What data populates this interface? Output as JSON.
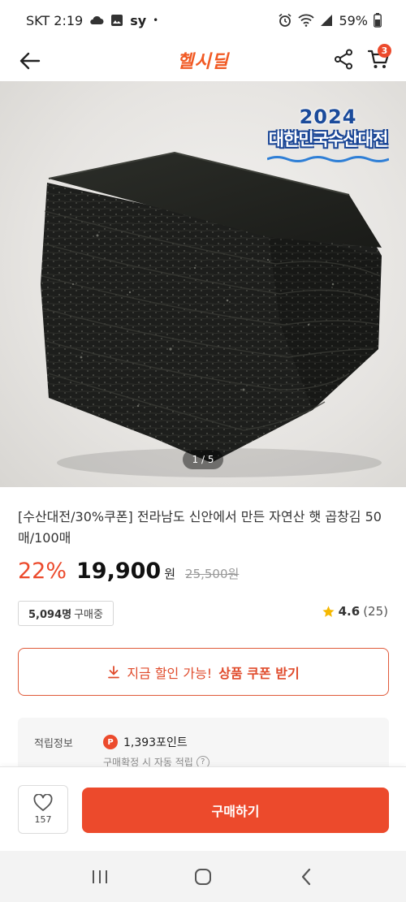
{
  "status_bar": {
    "carrier_time": "SKT 2:19",
    "notif_text": "sy",
    "dot": "•",
    "battery": "59%"
  },
  "header": {
    "logo": "헬시딜",
    "cart_count": "3",
    "icons": [
      "back-arrow-icon",
      "share-icon",
      "cart-icon"
    ]
  },
  "product_image": {
    "badge_year": "2024",
    "badge_title": "대한민국수산대전",
    "counter": "1 / 5"
  },
  "product": {
    "title": "[수산대전/30%쿠폰] 전라남도 신안에서 만든 자연산 햇 곱창김 50매/100매",
    "discount": "22%",
    "price": "19,900",
    "currency": "원",
    "original_price": "25,500원",
    "buyers_count": "5,094명",
    "buyers_suffix": "구매중",
    "rating": "4.6",
    "review_count": "(25)"
  },
  "coupon": {
    "prefix": "지금 할인 가능!",
    "label": "상품 쿠폰 받기"
  },
  "points": {
    "label": "적립정보",
    "icon_letter": "P",
    "value": "1,393포인트",
    "note": "구매확정 시 자동 적립"
  },
  "action_bar": {
    "wish_count": "157",
    "buy_label": "구매하기"
  },
  "colors": {
    "accent": "#ec4a2c",
    "logo": "#f15a24",
    "star": "#f5b800"
  }
}
